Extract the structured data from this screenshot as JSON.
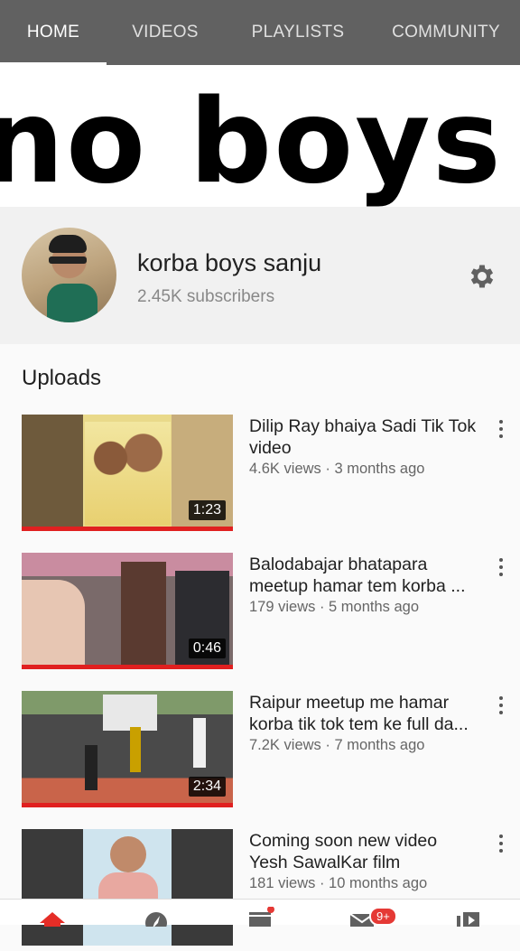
{
  "tabs": [
    {
      "label": "HOME",
      "active": true
    },
    {
      "label": "VIDEOS",
      "active": false
    },
    {
      "label": "PLAYLISTS",
      "active": false
    },
    {
      "label": "COMMUNITY",
      "active": false
    }
  ],
  "banner": {
    "text": "no boys sanju"
  },
  "channel": {
    "name": "korba boys sanju",
    "subscribers": "2.45K subscribers"
  },
  "section": {
    "title": "Uploads"
  },
  "videos": [
    {
      "title": "Dilip Ray bhaiya Sadi Tik Tok video",
      "meta": "4.6K views · 3 months ago",
      "duration": "1:23"
    },
    {
      "title_line1": "Balodabajar bhatapara",
      "title_line2": "meetup hamar tem korba ...",
      "meta": "179 views · 5 months ago",
      "duration": "0:46"
    },
    {
      "title_line1": "Raipur meetup me hamar",
      "title_line2": "korba tik tok tem ke full da...",
      "meta": "7.2K views · 7 months ago",
      "duration": "2:34"
    },
    {
      "title_line1": "Coming soon new video",
      "title_line2": "Yesh SawalKar film",
      "meta": "181 views · 10 months ago",
      "duration": ""
    }
  ],
  "bottom_nav": {
    "icons": [
      "home-icon",
      "explore-icon",
      "subscriptions-icon",
      "inbox-icon",
      "library-icon"
    ],
    "inbox_badge": "9+"
  },
  "colors": {
    "tab_bar": "#616161",
    "progress": "#e02020",
    "badge": "#e53935"
  }
}
